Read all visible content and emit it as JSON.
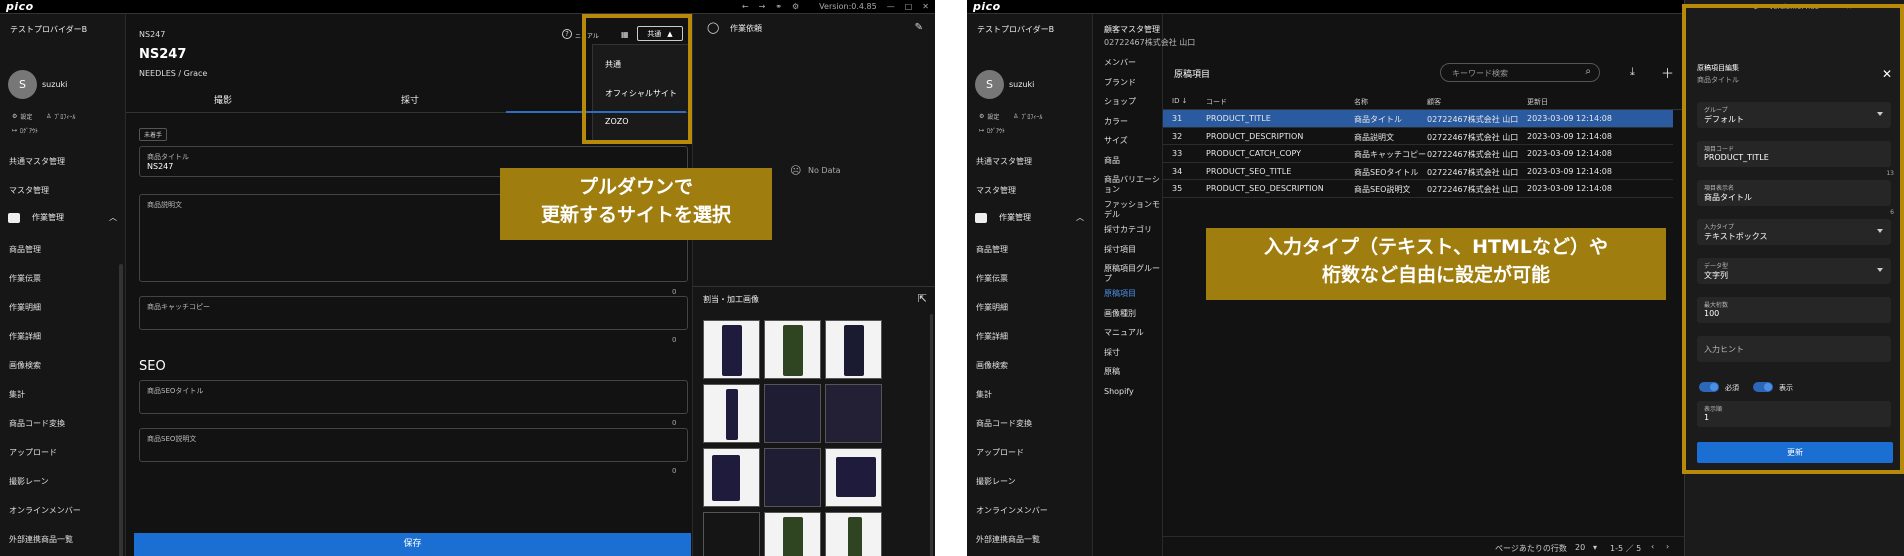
{
  "app": {
    "brand": "pico",
    "version": "Version:0.4.85"
  },
  "sidebar": {
    "provider": "テストプロバイダーB",
    "user_initial": "S",
    "user_name": "suzuki",
    "settings_label": "設定",
    "profile_label": "ﾌﾟﾛﾌｨｰﾙ",
    "logout_label": "ﾛｸﾞｱｳﾄ",
    "items": [
      "共通マスタ管理",
      "マスタ管理"
    ],
    "section_label": "作業管理",
    "section_items": [
      "商品管理",
      "作業伝票",
      "作業明細",
      "作業詳細",
      "画像検索",
      "集計",
      "商品コード変換",
      "アップロード",
      "撮影レーン",
      "オンラインメンバー",
      "外部連携商品一覧"
    ]
  },
  "left": {
    "code": "NS247",
    "title": "NS247",
    "subtitle": "NEEDLES / Grace",
    "manual_label": "ニュアル",
    "dropdown_value": "共通",
    "dropdown_options": [
      "共通",
      "オフィシャルサイト",
      "ZOZO"
    ],
    "tabs": [
      "撮影",
      "採寸"
    ],
    "status_chip": "未着手",
    "fields": [
      {
        "label": "商品タイトル",
        "value": "NS247"
      },
      {
        "label": "商品説明文",
        "value": "",
        "count": "0"
      },
      {
        "label": "商品キャッチコピー",
        "value": "",
        "count": "0"
      }
    ],
    "seo_heading": "SEO",
    "seo_fields": [
      {
        "label": "商品SEOタイトル",
        "count": "0"
      },
      {
        "label": "商品SEO説明文",
        "count": "0"
      }
    ],
    "save_label": "保存",
    "annotation": [
      "プルダウンで",
      "更新するサイトを選択"
    ]
  },
  "right_panel": {
    "work_request_title": "作業依頼",
    "no_data": "No Data",
    "images_title": "割当・加工画像"
  },
  "right": {
    "breadcrumb_title": "顧客マスタ管理",
    "breadcrumb_sub": "02722467株式会社 山口",
    "nav": [
      "メンバー",
      "ブランド",
      "ショップ",
      "カラー",
      "サイズ",
      "商品",
      "商品バリエーション",
      "ファッションモデル",
      "採寸カテゴリ",
      "採寸項目",
      "原稿項目グループ",
      "原稿項目",
      "画像種別",
      "マニュアル",
      "採寸",
      "原稿",
      "Shopify"
    ],
    "active_nav": "原稿項目",
    "table_title": "原稿項目",
    "search_placeholder": "キーワード検索",
    "columns": [
      "ID ↓",
      "コード",
      "名称",
      "顧客",
      "更新日"
    ],
    "rows": [
      [
        "31",
        "PRODUCT_TITLE",
        "商品タイトル",
        "02722467株式会社 山口",
        "2023-03-09 12:14:08"
      ],
      [
        "32",
        "PRODUCT_DESCRIPTION",
        "商品説明文",
        "02722467株式会社 山口",
        "2023-03-09 12:14:08"
      ],
      [
        "33",
        "PRODUCT_CATCH_COPY",
        "商品キャッチコピー",
        "02722467株式会社 山口",
        "2023-03-09 12:14:08"
      ],
      [
        "34",
        "PRODUCT_SEO_TITLE",
        "商品SEOタイトル",
        "02722467株式会社 山口",
        "2023-03-09 12:14:08"
      ],
      [
        "35",
        "PRODUCT_SEO_DESCRIPTION",
        "商品SEO説明文",
        "02722467株式会社 山口",
        "2023-03-09 12:14:08"
      ]
    ],
    "footer_rows_label": "ページあたりの行数",
    "footer_rows_value": "20",
    "footer_range": "1-5 ／ 5",
    "annotation": [
      "入力タイプ（テキスト、HTMLなど）や",
      "桁数など自由に設定が可能"
    ],
    "edit_panel": {
      "title": "原稿項目編集",
      "subtitle": "商品タイトル",
      "group_label": "グループ",
      "group_value": "デフォルト",
      "code_label": "項目コード",
      "code_value": "PRODUCT_TITLE",
      "code_count": "13",
      "name_label": "項目表示名",
      "name_value": "商品タイトル",
      "name_count": "6",
      "input_type_label": "入力タイプ",
      "input_type_value": "テキストボックス",
      "data_type_label": "データ型",
      "data_type_value": "文字列",
      "max_label": "最大桁数",
      "max_value": "100",
      "hint_label": "入力ヒント",
      "required_label": "必須",
      "display_label": "表示",
      "order_label": "表示順",
      "order_value": "1",
      "update_label": "更新"
    }
  }
}
